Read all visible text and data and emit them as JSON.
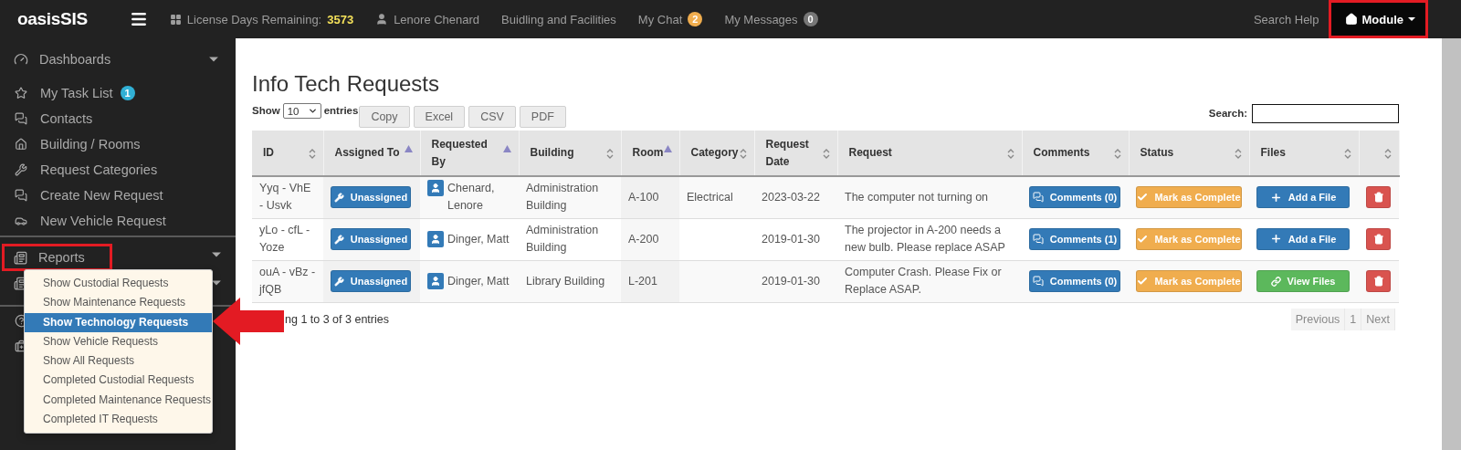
{
  "brand": "oasisSIS",
  "topbar": {
    "items": [
      {
        "kind": "license",
        "label": "License Days Remaining:",
        "value": "3573"
      },
      {
        "kind": "user",
        "label": "Lenore Chenard"
      },
      {
        "kind": "link",
        "label": "Buidling and Facilities"
      },
      {
        "kind": "badge",
        "label": "My Chat",
        "badge": "2",
        "color": "#f0ad4e"
      },
      {
        "kind": "badge",
        "label": "My Messages",
        "badge": "0",
        "color": "#777777"
      }
    ],
    "search_help": "Search Help",
    "module": {
      "label": "Module",
      "highlighted": true
    }
  },
  "sidebar": {
    "groups": [
      {
        "header": {
          "label": "Dashboards",
          "highlighted": false
        },
        "items": [
          {
            "label": "My Task List",
            "badge": "1"
          },
          {
            "label": "Contacts"
          },
          {
            "label": "Building / Rooms"
          },
          {
            "label": "Request Categories"
          },
          {
            "label": "Create New Request"
          },
          {
            "label": "New Vehicle Request"
          }
        ]
      },
      {
        "header": {
          "label": "Reports",
          "highlighted": true
        }
      }
    ]
  },
  "report_menu": {
    "items": [
      {
        "label": "Show Custodial Requests",
        "selected": false
      },
      {
        "label": "Show Maintenance Requests",
        "selected": false
      },
      {
        "label": "Show Technology Requests",
        "selected": true
      },
      {
        "label": "Show Vehicle Requests",
        "selected": false
      },
      {
        "label": "Show All Requests",
        "selected": false
      },
      {
        "label": "Completed Custodial Requests",
        "selected": false
      },
      {
        "label": "Completed Maintenance Requests",
        "selected": false
      },
      {
        "label": "Completed IT Requests",
        "selected": false
      }
    ]
  },
  "page_title": "Info Tech Requests",
  "table": {
    "show_label": "Show",
    "length": "10",
    "entries_label": "entries",
    "export_buttons": [
      "Copy",
      "Excel",
      "CSV",
      "PDF"
    ],
    "search_label": "Search:",
    "columns": [
      {
        "label": "ID",
        "sorted_ascending": false
      },
      {
        "label": "Assigned To",
        "sorted_ascending": true
      },
      {
        "label": "Requested By",
        "sorted_ascending": true
      },
      {
        "label": "Building",
        "sorted_ascending": false
      },
      {
        "label": "Room",
        "sorted_ascending": true
      },
      {
        "label": "Category",
        "sorted_ascending": false
      },
      {
        "label": "Request Date",
        "sorted_ascending": false
      },
      {
        "label": "Request",
        "sorted_ascending": false
      },
      {
        "label": "Comments",
        "sorted_ascending": false
      },
      {
        "label": "Status",
        "sorted_ascending": false
      },
      {
        "label": "Files",
        "sorted_ascending": false
      },
      {
        "sorted_ascending": false
      }
    ],
    "rows": [
      {
        "id": "Yyq - VhE - Usvk",
        "assigned": "Unassigned",
        "requested_by": "Chenard, Lenore",
        "building": "Administration Building",
        "room": "A-100",
        "category": "Electrical",
        "date": "2023-03-22",
        "request": "The computer not turning on",
        "comments": "Comments (0)",
        "status": "Mark as Complete",
        "files": {
          "kind": "add",
          "label": "Add a File"
        }
      },
      {
        "id": "yLo - cfL - Yoze",
        "assigned": "Unassigned",
        "requested_by": "Dinger, Matt",
        "building": "Administration Building",
        "room": "A-200",
        "date": "2019-01-30",
        "request": "The projector in A-200 needs a new bulb. Please replace ASAP",
        "comments": "Comments (1)",
        "status": "Mark as Complete",
        "files": {
          "kind": "add",
          "label": "Add a File"
        }
      },
      {
        "id": "ouA - vBz - jfQB",
        "assigned": "Unassigned",
        "requested_by": "Dinger, Matt",
        "building": "Library Building",
        "room": "L-201",
        "date": "2019-01-30",
        "request": "Computer Crash. Please Fix or Replace ASAP.",
        "comments": "Comments (0)",
        "status": "Mark as Complete",
        "files": {
          "kind": "view",
          "label": "View Files"
        }
      }
    ],
    "info": "ng 1 to 3 of 3 entries",
    "pagination": [
      "Previous",
      "1",
      "Next"
    ]
  }
}
